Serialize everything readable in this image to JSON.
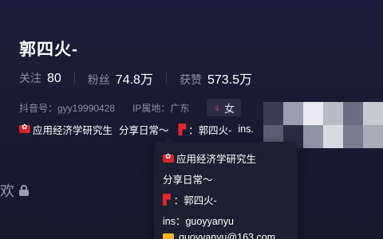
{
  "profile": {
    "name": "郭四火-",
    "stats": [
      {
        "label": "关注",
        "value": "80"
      },
      {
        "label": "粉丝",
        "value": "74.8万"
      },
      {
        "label": "获赞",
        "value": "573.5万"
      }
    ],
    "douyin_id": "抖音号：gyy19990428",
    "ip_location": "IP属地：广东",
    "gender": {
      "symbol": "♀",
      "label": "女"
    },
    "bio": {
      "title": "应用经济学研究生",
      "daily": "分享日常～",
      "alias_sep": "：",
      "alias": "郭四火-",
      "ins_prefix": "ins."
    }
  },
  "popover": {
    "line1": "应用经济学研究生",
    "line2": "分享日常～",
    "line3_sep": "：",
    "line3": "郭四火-",
    "line4": "ins：guoyyanyu",
    "line5": "guoyyanyu@163.com"
  },
  "tab": {
    "label": "欢"
  },
  "colors": {
    "accent_red": "#e5272e",
    "gender_pink": "#ff4f7a",
    "mail_yellow": "#f0b429"
  },
  "mosaic_colors": [
    "#3b3d55",
    "#9b9eae",
    "#e9e9ef",
    "#b8bac6",
    "#6b6d80",
    "#c7c9d2",
    "#5c5e72",
    "#2a2c42",
    "#8f92a3",
    "#d9dae1",
    "#7a7c8e",
    "#a9abb8"
  ]
}
